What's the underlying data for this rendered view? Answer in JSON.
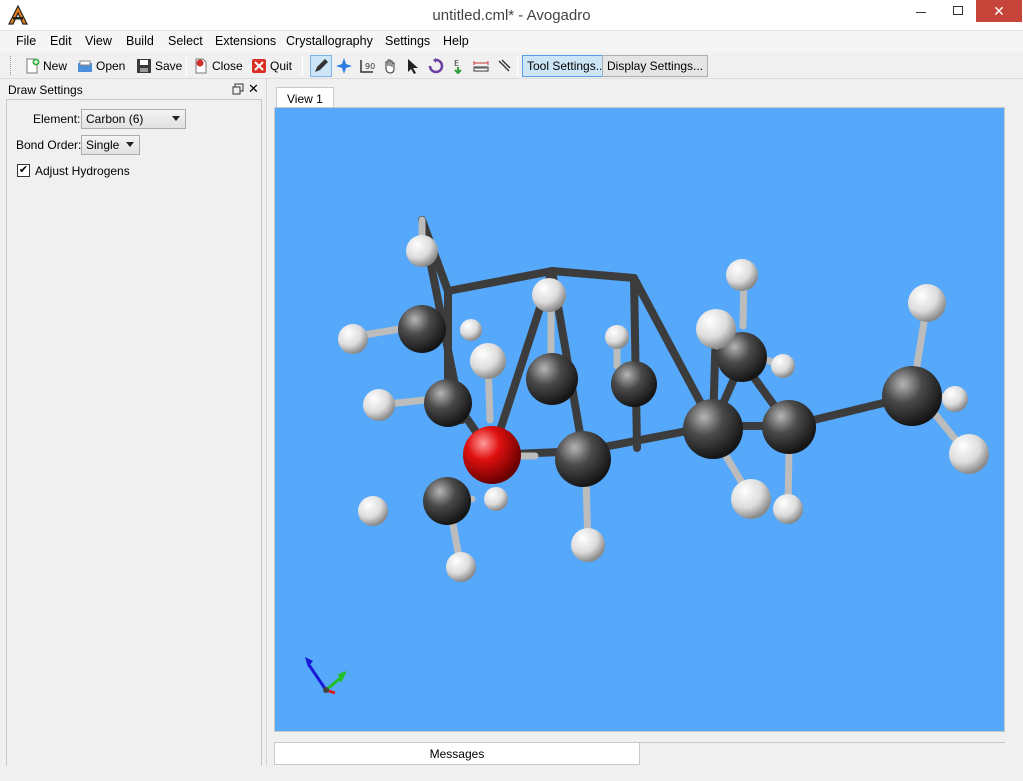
{
  "window": {
    "title": "untitled.cml* - Avogadro",
    "close_glyph": "✕"
  },
  "menu": [
    "File",
    "Edit",
    "View",
    "Build",
    "Select",
    "Extensions",
    "Crystallography",
    "Settings",
    "Help"
  ],
  "toolbar": {
    "new": "New",
    "open": "Open",
    "save": "Save",
    "close": "Close",
    "quit": "Quit",
    "tool_settings": "Tool Settings...",
    "display_settings": "Display Settings...",
    "tools": [
      "draw-tool",
      "navigate-tool",
      "bond-centric-manipulate-tool",
      "manipulate-tool",
      "select-tool",
      "auto-rotate-tool",
      "auto-optimize-tool",
      "measure-tool",
      "align-tool"
    ],
    "active_tool": "draw-tool"
  },
  "dock": {
    "title": "Draw Settings",
    "element_label": "Element:",
    "element_value": "Carbon (6)",
    "bond_order_label": "Bond Order:",
    "bond_order_value": "Single",
    "adjust_hydrogens_label": "Adjust Hydrogens",
    "adjust_hydrogens_checked": true
  },
  "view_tab": "View 1",
  "messages_tab": "Messages",
  "colors": {
    "viewport_bg": "#55a8fa",
    "carbon": "#4a4a4a",
    "oxygen": "#e01010",
    "hydrogen": "#f0f0f0",
    "accent": "#cde6f7"
  }
}
